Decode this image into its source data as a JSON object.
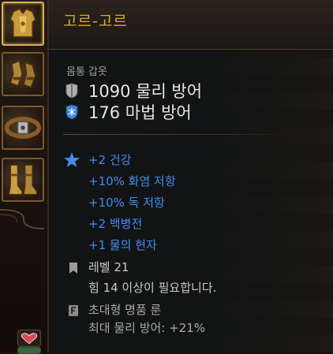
{
  "equipment_slots": [
    {
      "name": "chest-armor",
      "selected": true
    },
    {
      "name": "gloves",
      "selected": false
    },
    {
      "name": "belt",
      "selected": false
    },
    {
      "name": "boots",
      "selected": false
    }
  ],
  "tooltip": {
    "item_name": "고르-고르",
    "item_type": "몸통 갑옷",
    "stats": [
      {
        "icon": "shield-icon",
        "text": "1090 물리 방어"
      },
      {
        "icon": "snowflake-icon",
        "text": "176 마법 방어"
      }
    ],
    "bonuses": [
      "+2 건강",
      "+10% 화염 저항",
      "+10% 독 저항",
      "+2 백병전",
      "+1 물의 현자"
    ],
    "level_requirement": "레벨 21",
    "strength_requirement": "힘 14 이상이 필요합니다.",
    "rune_name": "초대형 명품 룬",
    "rune_effect": "최대 물리 방어: +21%"
  },
  "colors": {
    "item_name": "#e0a82e",
    "bonus_text": "#3f8ef0",
    "stat_text": "#e6e6e6",
    "slot_border": "#7a5a2c"
  }
}
